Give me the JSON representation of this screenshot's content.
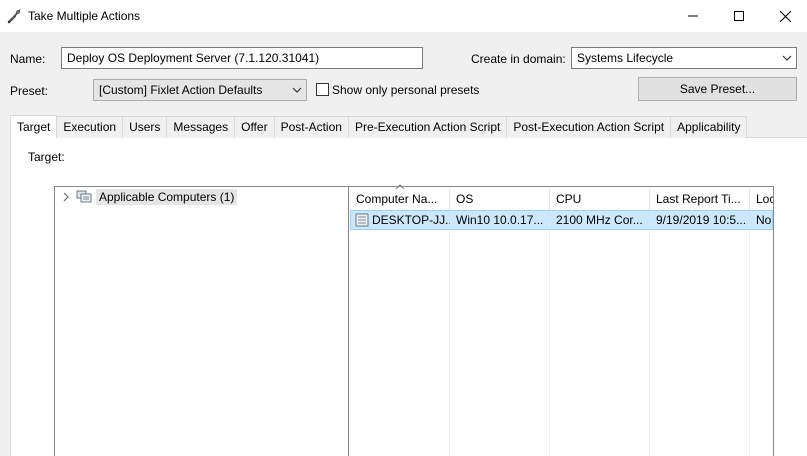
{
  "window": {
    "title": "Take Multiple Actions",
    "icon": "wrench-icon",
    "controls": [
      "minimize-icon",
      "maximize-icon",
      "close-icon"
    ]
  },
  "form": {
    "name_label": "Name:",
    "name_value": "Deploy OS Deployment Server (7.1.120.31041)",
    "domain_label": "Create in domain:",
    "domain_value": "Systems Lifecycle",
    "preset_label": "Preset:",
    "preset_value": "[Custom] Fixlet Action Defaults",
    "personal_presets_label": "Show only personal presets",
    "personal_presets_checked": false,
    "save_preset_label": "Save Preset..."
  },
  "tabs": [
    {
      "label": "Target",
      "active": true
    },
    {
      "label": "Execution",
      "active": false
    },
    {
      "label": "Users",
      "active": false
    },
    {
      "label": "Messages",
      "active": false
    },
    {
      "label": "Offer",
      "active": false
    },
    {
      "label": "Post-Action",
      "active": false
    },
    {
      "label": "Pre-Execution Action Script",
      "active": false
    },
    {
      "label": "Post-Execution Action Script",
      "active": false
    },
    {
      "label": "Applicability",
      "active": false
    }
  ],
  "target": {
    "label": "Target:",
    "tree": {
      "label": "Applicable Computers (1)",
      "icon": "computer-group-icon"
    },
    "columns": [
      "Computer Na...",
      "OS",
      "CPU",
      "Last Report Ti...",
      "Loc"
    ],
    "rows": [
      {
        "icon": "computer-icon",
        "cells": [
          "DESKTOP-JJ...",
          "Win10 10.0.17...",
          "2100 MHz Cor...",
          "9/19/2019 10:5...",
          "No"
        ]
      }
    ]
  }
}
